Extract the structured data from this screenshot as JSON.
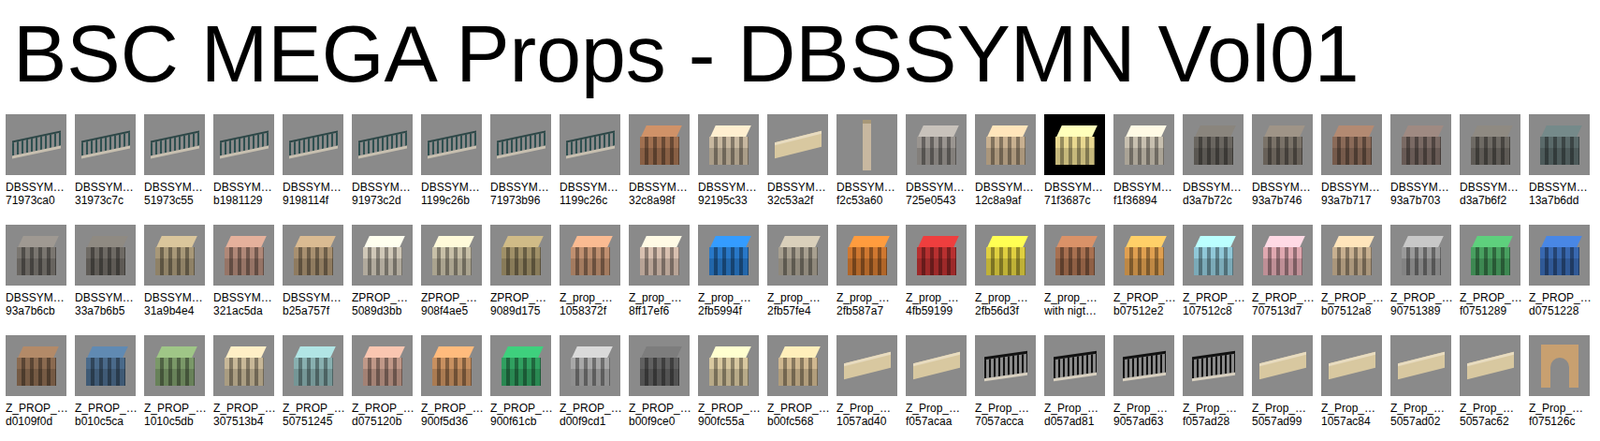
{
  "title": "BSC MEGA Props - DBSSYMN Vol01",
  "rows": [
    {
      "items": [
        {
          "name": "DBSSYM…",
          "id": "71973ca0",
          "kind": "fence"
        },
        {
          "name": "DBSSYM…",
          "id": "31973c7c",
          "kind": "fence"
        },
        {
          "name": "DBSSYM…",
          "id": "51973c55",
          "kind": "fence"
        },
        {
          "name": "DBSSYM…",
          "id": "b1981129",
          "kind": "fence"
        },
        {
          "name": "DBSSYM…",
          "id": "9198114f",
          "kind": "fence"
        },
        {
          "name": "DBSSYM…",
          "id": "91973c2d",
          "kind": "fence"
        },
        {
          "name": "DBSSYM…",
          "id": "1199c26b",
          "kind": "fence"
        },
        {
          "name": "DBSSYM…",
          "id": "71973b96",
          "kind": "fence"
        },
        {
          "name": "DBSSYM…",
          "id": "1199c26c",
          "kind": "fence"
        },
        {
          "name": "DBSSYM…",
          "id": "32c8a98f",
          "kind": "building",
          "color": "#a07050"
        },
        {
          "name": "DBSSYM…",
          "id": "92195c33",
          "kind": "building",
          "color": "#c8b8a0"
        },
        {
          "name": "DBSSYM…",
          "id": "32c53a2f",
          "kind": "wall"
        },
        {
          "name": "DBSSYM…",
          "id": "f2c53a60",
          "kind": "column"
        },
        {
          "name": "DBSSYM…",
          "id": "725e0543",
          "kind": "building",
          "color": "#9a9590"
        },
        {
          "name": "DBSSYM…",
          "id": "12c8a9af",
          "kind": "building",
          "color": "#c8b090"
        },
        {
          "name": "DBSSYM…",
          "id": "71f3687c",
          "kind": "night",
          "color": "#e8d890"
        },
        {
          "name": "DBSSYM…",
          "id": "f1f36894",
          "kind": "building",
          "color": "#c8c0b0"
        },
        {
          "name": "DBSSYM…",
          "id": "d3a7b72c",
          "kind": "building",
          "color": "#6a6660"
        },
        {
          "name": "DBSSYM…",
          "id": "93a7b746",
          "kind": "building",
          "color": "#7a7268"
        },
        {
          "name": "DBSSYM…",
          "id": "93a7b717",
          "kind": "building",
          "color": "#8a6a58"
        },
        {
          "name": "DBSSYM…",
          "id": "93a7b703",
          "kind": "building",
          "color": "#7a6a64"
        },
        {
          "name": "DBSSYM…",
          "id": "d3a7b6f2",
          "kind": "building",
          "color": "#6e6a64"
        },
        {
          "name": "DBSSYM…",
          "id": "13a7b6dd",
          "kind": "building",
          "color": "#5a6a6a"
        }
      ]
    },
    {
      "items": [
        {
          "name": "DBSSYM…",
          "id": "93a7b6cb",
          "kind": "building",
          "color": "#7a7670"
        },
        {
          "name": "DBSSYM…",
          "id": "33a7b6b5",
          "kind": "building",
          "color": "#6e6a64"
        },
        {
          "name": "DBSSYM…",
          "id": "31a9b4e4",
          "kind": "building",
          "color": "#a89878"
        },
        {
          "name": "DBSSYM…",
          "id": "321ac5da",
          "kind": "building",
          "color": "#b08878"
        },
        {
          "name": "DBSSYM…",
          "id": "b25a757f",
          "kind": "building",
          "color": "#a89070"
        },
        {
          "name": "ZPROP_…",
          "id": "5089d3bb",
          "kind": "building",
          "color": "#d0c8b8"
        },
        {
          "name": "ZPROP_…",
          "id": "908f4ae5",
          "kind": "building",
          "color": "#c8c0a8"
        },
        {
          "name": "ZPROP_…",
          "id": "9089d175",
          "kind": "building",
          "color": "#a09068"
        },
        {
          "name": "Z_prop_…",
          "id": "1058372f",
          "kind": "building",
          "color": "#c09070"
        },
        {
          "name": "Z_prop_…",
          "id": "8ff17ef6",
          "kind": "building",
          "color": "#d8c0b0"
        },
        {
          "name": "Z_prop_…",
          "id": "2fb5994f",
          "kind": "building",
          "color": "#2878c8"
        },
        {
          "name": "Z_prop_…",
          "id": "2fb57fe4",
          "kind": "building",
          "color": "#a8a090"
        },
        {
          "name": "Z_prop_…",
          "id": "2fb587a7",
          "kind": "building",
          "color": "#d07830"
        },
        {
          "name": "Z_prop_…",
          "id": "4fb59199",
          "kind": "building",
          "color": "#b83030"
        },
        {
          "name": "Z_prop_…",
          "id": "2fb56d3f",
          "kind": "building",
          "color": "#e0d040"
        },
        {
          "name": "Z_prop_…",
          "id": "with nigt…",
          "kind": "building",
          "color": "#a87050"
        },
        {
          "name": "Z_PROP_…",
          "id": "b07512e2",
          "kind": "building",
          "color": "#e0a050"
        },
        {
          "name": "Z_PROP_…",
          "id": "107512c8",
          "kind": "building",
          "color": "#90c8d8"
        },
        {
          "name": "Z_PROP_…",
          "id": "707513d7",
          "kind": "building",
          "color": "#e0a8b0"
        },
        {
          "name": "Z_PROP_…",
          "id": "b07512a8",
          "kind": "building",
          "color": "#c8b090"
        },
        {
          "name": "Z_PROP_…",
          "id": "90751389",
          "kind": "building",
          "color": "#9a9a9a"
        },
        {
          "name": "Z_PROP_…",
          "id": "f0751289",
          "kind": "building",
          "color": "#48a060"
        },
        {
          "name": "Z_PROP_…",
          "id": "d0751228",
          "kind": "building",
          "color": "#3868b0"
        }
      ]
    },
    {
      "items": [
        {
          "name": "Z_PROP_…",
          "id": "d0109f0d",
          "kind": "building",
          "color": "#8a6a50"
        },
        {
          "name": "Z_PROP_…",
          "id": "b010c5ca",
          "kind": "building",
          "color": "#4a6a8a"
        },
        {
          "name": "Z_PROP_…",
          "id": "1010c5db",
          "kind": "building",
          "color": "#7a9868"
        },
        {
          "name": "Z_PROP_…",
          "id": "307513b4",
          "kind": "building",
          "color": "#c8b898"
        },
        {
          "name": "Z_PROP_…",
          "id": "50751245",
          "kind": "building",
          "color": "#88b0b0"
        },
        {
          "name": "Z_PROP_…",
          "id": "d075120b",
          "kind": "building",
          "color": "#c09888"
        },
        {
          "name": "Z_PROP_…",
          "id": "900f5d36",
          "kind": "building",
          "color": "#c89060"
        },
        {
          "name": "Z_PROP_…",
          "id": "900f61cb",
          "kind": "building",
          "color": "#30a060"
        },
        {
          "name": "Z_PROP_…",
          "id": "d00f9cd1",
          "kind": "building",
          "color": "#a8a8a8"
        },
        {
          "name": "Z_PROP_…",
          "id": "b00f9ce0",
          "kind": "building",
          "color": "#606060"
        },
        {
          "name": "Z_PROP_…",
          "id": "900fc55a",
          "kind": "building",
          "color": "#d8c8a0"
        },
        {
          "name": "Z_PROP_…",
          "id": "b00fc568",
          "kind": "building",
          "color": "#d0b890"
        },
        {
          "name": "Z_Prop_…",
          "id": "1057ad40",
          "kind": "wall"
        },
        {
          "name": "Z_Prop_…",
          "id": "f057acaa",
          "kind": "wall"
        },
        {
          "name": "Z_Prop_…",
          "id": "7057acca",
          "kind": "gate"
        },
        {
          "name": "Z_Prop_…",
          "id": "d057ad81",
          "kind": "gate"
        },
        {
          "name": "Z_Prop_…",
          "id": "9057ad63",
          "kind": "gate"
        },
        {
          "name": "Z_Prop_…",
          "id": "f057ad28",
          "kind": "gate"
        },
        {
          "name": "Z_Prop_…",
          "id": "5057ad99",
          "kind": "wall"
        },
        {
          "name": "Z_Prop_…",
          "id": "1057ac84",
          "kind": "wall"
        },
        {
          "name": "Z_Prop_…",
          "id": "5057ad02",
          "kind": "wall"
        },
        {
          "name": "Z_Prop_…",
          "id": "5057ac62",
          "kind": "wall"
        },
        {
          "name": "Z_Prop_…",
          "id": "f075126c",
          "kind": "arch"
        }
      ]
    }
  ]
}
